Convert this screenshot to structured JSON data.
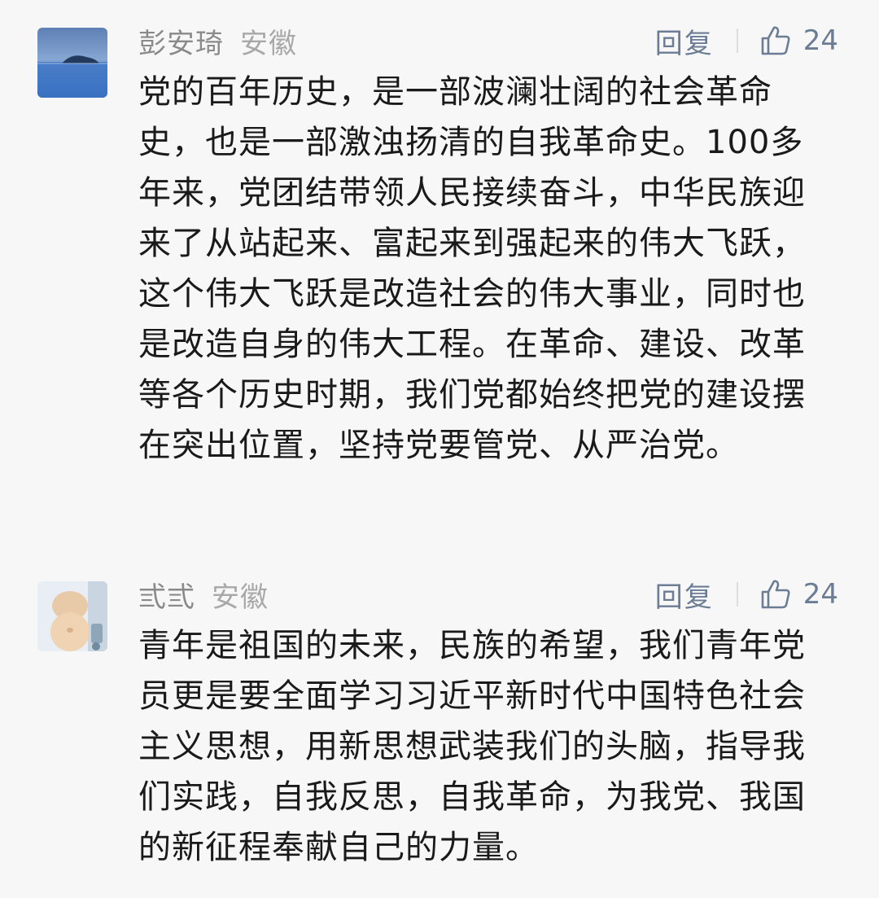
{
  "comments": [
    {
      "name": "彭安琦",
      "region": "安徽",
      "reply_label": "回复",
      "like_icon": "thumbs-up-icon",
      "likes": "24",
      "content": "党的百年历史，是一部波澜壮阔的社会革命史，也是一部激浊扬清的自我革命史。100多年来，党团结带领人民接续奋斗，中华民族迎来了从站起来、富起来到强起来的伟大飞跃，这个伟大飞跃是改造社会的伟大事业，同时也是改造自身的伟大工程。在革命、建设、改革等各个历史时期，我们党都始终把党的建设摆在突出位置，坚持党要管党、从严治党。"
    },
    {
      "name": "弎弎",
      "region": "安徽",
      "reply_label": "回复",
      "like_icon": "thumbs-up-icon",
      "likes": "24",
      "content": "青年是祖国的未来，民族的希望，我们青年党员更是要全面学习习近平新时代中国特色社会主义思想，用新思想武装我们的头脑，指导我们实践，自我反思，自我革命，为我党、我国的新征程奉献自己的力量。"
    }
  ],
  "colors": {
    "background": "#f7f7f7",
    "name": "#8a8a8a",
    "action": "#6b7c95",
    "content": "#1a1a1a"
  }
}
